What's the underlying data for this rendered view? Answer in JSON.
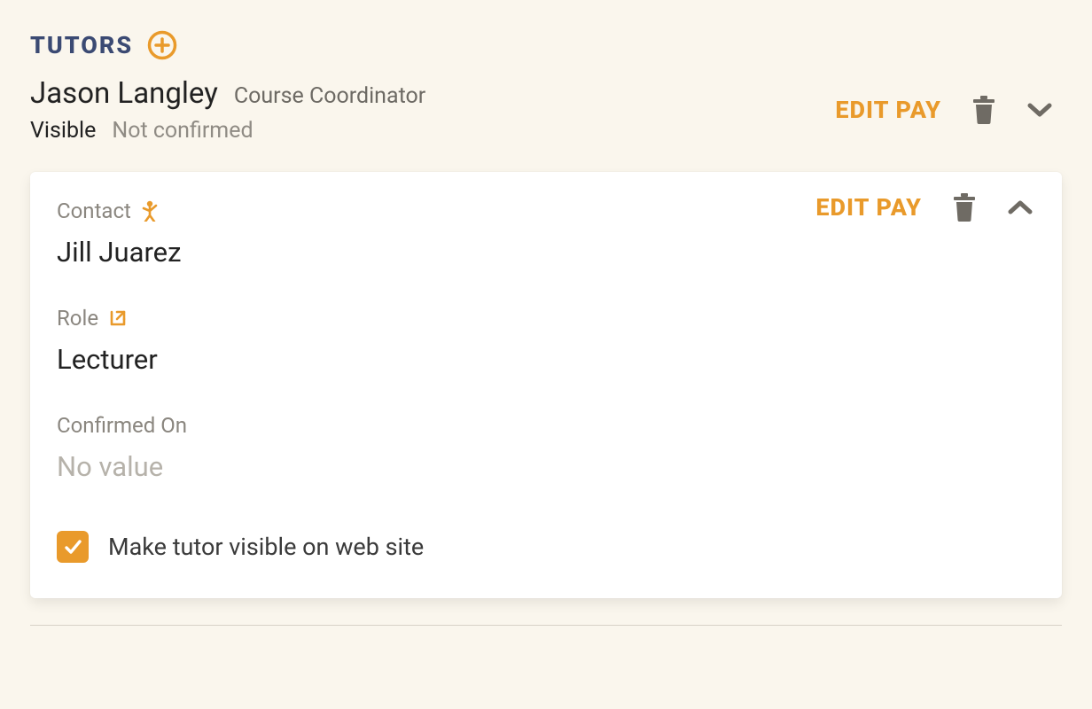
{
  "section": {
    "title": "TUTORS"
  },
  "tutors": [
    {
      "name": "Jason Langley",
      "role": "Course Coordinator",
      "visibility": "Visible",
      "confirmation": "Not confirmed",
      "editPayLabel": "EDIT PAY"
    },
    {
      "editPayLabel": "EDIT PAY",
      "fields": {
        "contactLabel": "Contact",
        "contactValue": "Jill Juarez",
        "roleLabel": "Role",
        "roleValue": "Lecturer",
        "confirmedLabel": "Confirmed On",
        "confirmedValue": "No value"
      },
      "visibleCheckboxLabel": "Make tutor visible on web site",
      "visibleChecked": true
    }
  ],
  "colors": {
    "accent": "#e99a2b",
    "heading": "#3b4a73",
    "muted": "#8a867f",
    "iconGrey": "#6f6b64"
  }
}
